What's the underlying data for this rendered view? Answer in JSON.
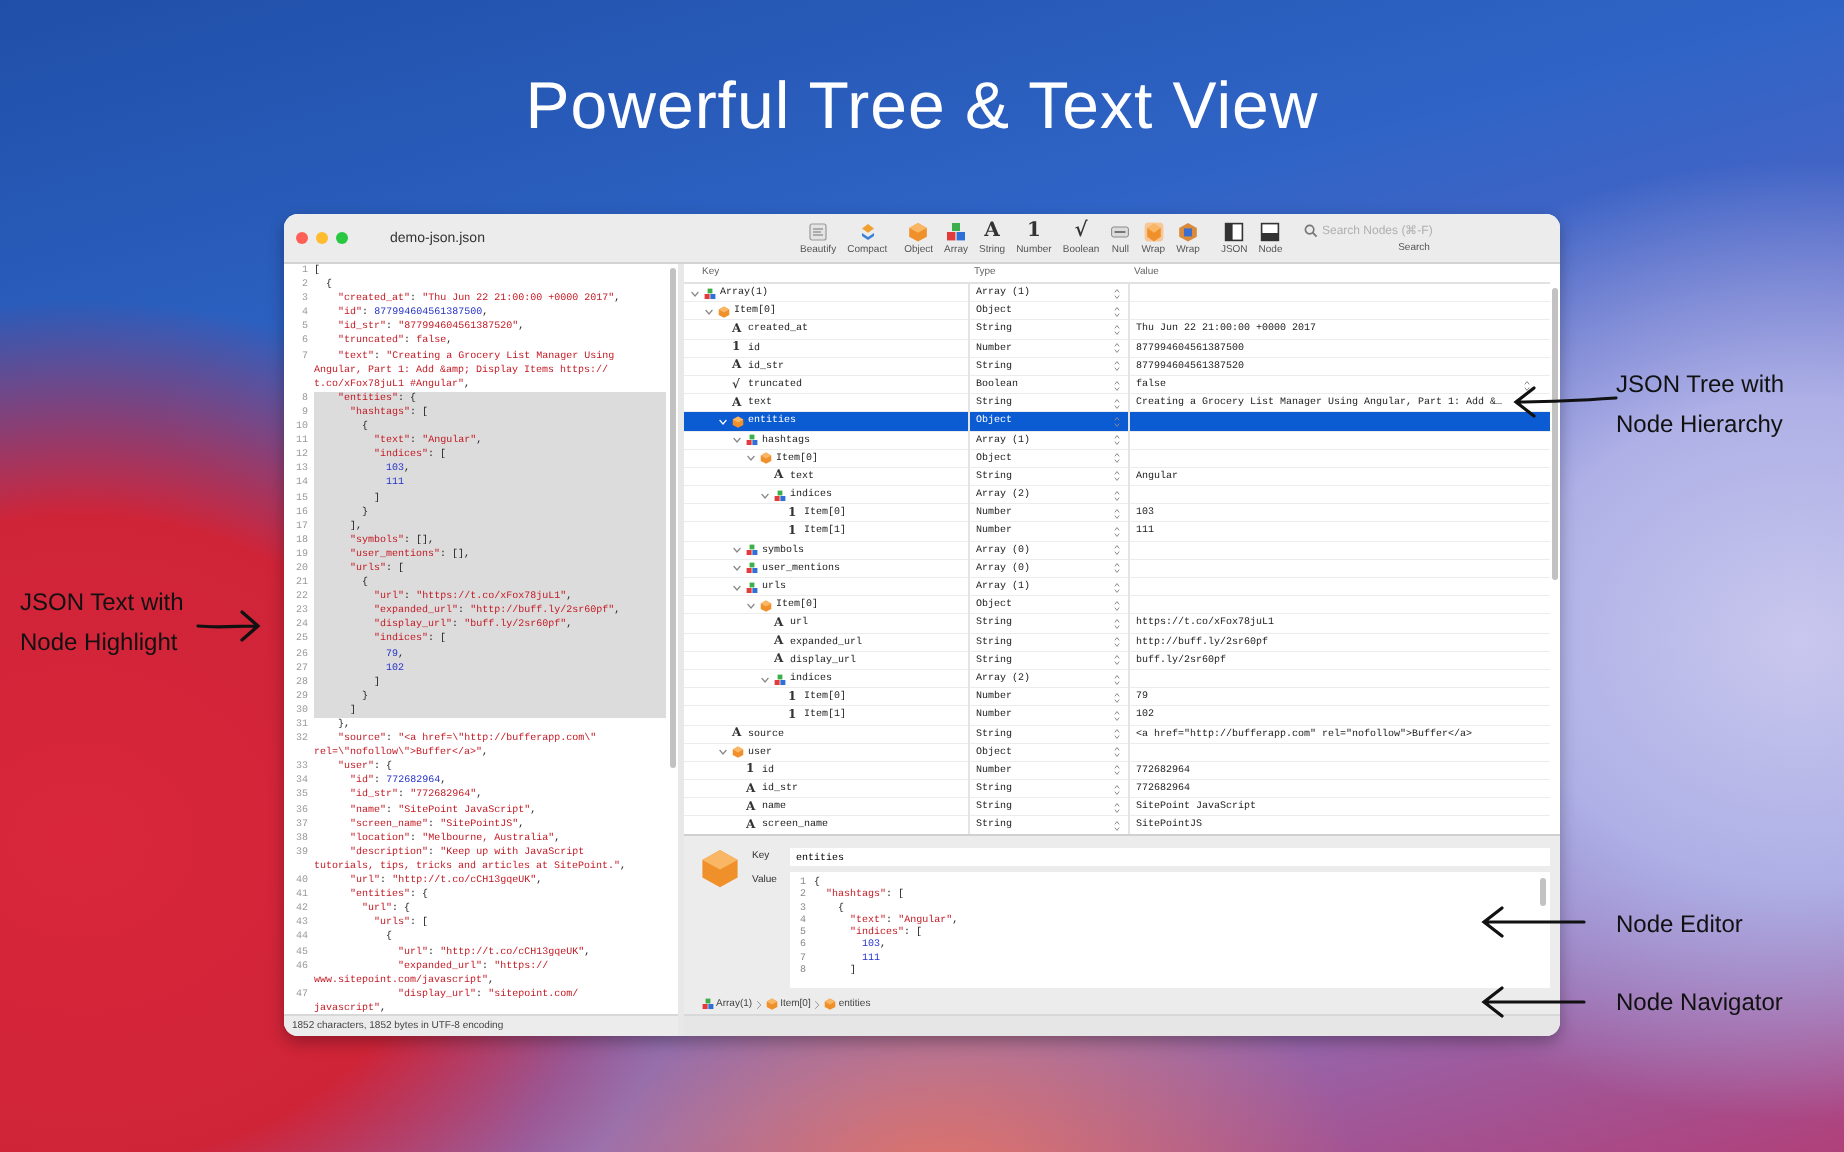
{
  "page_title": "Powerful Tree & Text View",
  "annotations": [
    {
      "kind": "tree",
      "lines": [
        "JSON Tree with",
        "Node Hierarchy"
      ]
    },
    {
      "kind": "text",
      "lines": [
        "JSON Text with",
        "Node Highlight"
      ]
    },
    {
      "kind": "editor",
      "lines": [
        "Node Editor"
      ]
    },
    {
      "kind": "navigator",
      "lines": [
        "Node Navigator"
      ]
    }
  ],
  "window": {
    "title": "demo-json.json",
    "toolbar": [
      {
        "kind": "beautify",
        "label": "Beautify"
      },
      {
        "kind": "compact",
        "label": "Compact"
      },
      {
        "kind": "object",
        "label": "Object"
      },
      {
        "kind": "array",
        "label": "Array"
      },
      {
        "kind": "string",
        "label": "String",
        "icon": "A"
      },
      {
        "kind": "number",
        "label": "Number",
        "icon": "1"
      },
      {
        "kind": "boolean",
        "label": "Boolean",
        "icon": "√"
      },
      {
        "kind": "null",
        "label": "Null"
      },
      {
        "kind": "wrap-object",
        "label": "Wrap"
      },
      {
        "kind": "wrap-array",
        "label": "Wrap"
      },
      {
        "kind": "json-panel",
        "label": "JSON"
      },
      {
        "kind": "node-panel",
        "label": "Node"
      }
    ],
    "search": {
      "placeholder": "Search Nodes (⌘-F)",
      "label": "Search"
    }
  },
  "text_view": {
    "lines": [
      {
        "n": "1",
        "text": "[",
        "highlighted": false
      },
      {
        "n": "2",
        "text": "  {",
        "highlighted": false
      },
      {
        "n": "3",
        "text": "    \"created_at\": \"Thu Jun 22 21:00:00 +0000 2017\",",
        "highlighted": false
      },
      {
        "n": "4",
        "text": "    \"id\": 877994604561387500,",
        "highlighted": false
      },
      {
        "n": "5",
        "text": "    \"id_str\": \"877994604561387520\",",
        "highlighted": false
      },
      {
        "n": "6",
        "text": "    \"truncated\": false,",
        "highlighted": false
      },
      {
        "n": "7",
        "text": "    \"text\": \"Creating a Grocery List Manager Using",
        "highlighted": false
      },
      {
        "text": "Angular, Part 1: Add &amp; Display Items https://",
        "highlighted": false
      },
      {
        "text": "t.co/xFox78juL1 #Angular\",",
        "highlighted": false
      },
      {
        "n": "8",
        "text": "    \"entities\": {",
        "highlighted": true
      },
      {
        "n": "9",
        "text": "      \"hashtags\": [",
        "highlighted": true
      },
      {
        "n": "10",
        "text": "        {",
        "highlighted": true
      },
      {
        "n": "11",
        "text": "          \"text\": \"Angular\",",
        "highlighted": true
      },
      {
        "n": "12",
        "text": "          \"indices\": [",
        "highlighted": true
      },
      {
        "n": "13",
        "text": "            103,",
        "highlighted": true
      },
      {
        "n": "14",
        "text": "            111",
        "highlighted": true
      },
      {
        "n": "15",
        "text": "          ]",
        "highlighted": true
      },
      {
        "n": "16",
        "text": "        }",
        "highlighted": true
      },
      {
        "n": "17",
        "text": "      ],",
        "highlighted": true
      },
      {
        "n": "18",
        "text": "      \"symbols\": [],",
        "highlighted": true
      },
      {
        "n": "19",
        "text": "      \"user_mentions\": [],",
        "highlighted": true
      },
      {
        "n": "20",
        "text": "      \"urls\": [",
        "highlighted": true
      },
      {
        "n": "21",
        "text": "        {",
        "highlighted": true
      },
      {
        "n": "22",
        "text": "          \"url\": \"https://t.co/xFox78juL1\",",
        "highlighted": true
      },
      {
        "n": "23",
        "text": "          \"expanded_url\": \"http://buff.ly/2sr60pf\",",
        "highlighted": true
      },
      {
        "n": "24",
        "text": "          \"display_url\": \"buff.ly/2sr60pf\",",
        "highlighted": true
      },
      {
        "n": "25",
        "text": "          \"indices\": [",
        "highlighted": true
      },
      {
        "n": "26",
        "text": "            79,",
        "highlighted": true
      },
      {
        "n": "27",
        "text": "            102",
        "highlighted": true
      },
      {
        "n": "28",
        "text": "          ]",
        "highlighted": true
      },
      {
        "n": "29",
        "text": "        }",
        "highlighted": true
      },
      {
        "n": "30",
        "text": "      ]",
        "highlighted": true
      },
      {
        "n": "31",
        "text": "    },",
        "highlighted": false
      },
      {
        "n": "32",
        "text": "    \"source\": \"<a href=\\\"http://bufferapp.com\\\"",
        "highlighted": false
      },
      {
        "text": "rel=\\\"nofollow\\\">Buffer</a>\",",
        "highlighted": false
      },
      {
        "n": "33",
        "text": "    \"user\": {",
        "highlighted": false
      },
      {
        "n": "34",
        "text": "      \"id\": 772682964,",
        "highlighted": false
      },
      {
        "n": "35",
        "text": "      \"id_str\": \"772682964\",",
        "highlighted": false
      },
      {
        "n": "36",
        "text": "      \"name\": \"SitePoint JavaScript\",",
        "highlighted": false
      },
      {
        "n": "37",
        "text": "      \"screen_name\": \"SitePointJS\",",
        "highlighted": false
      },
      {
        "n": "38",
        "text": "      \"location\": \"Melbourne, Australia\",",
        "highlighted": false
      },
      {
        "n": "39",
        "text": "      \"description\": \"Keep up with JavaScript",
        "highlighted": false
      },
      {
        "text": "tutorials, tips, tricks and articles at SitePoint.\",",
        "highlighted": false
      },
      {
        "n": "40",
        "text": "      \"url\": \"http://t.co/cCH13gqeUK\",",
        "highlighted": false
      },
      {
        "n": "41",
        "text": "      \"entities\": {",
        "highlighted": false
      },
      {
        "n": "42",
        "text": "        \"url\": {",
        "highlighted": false
      },
      {
        "n": "43",
        "text": "          \"urls\": [",
        "highlighted": false
      },
      {
        "n": "44",
        "text": "            {",
        "highlighted": false
      },
      {
        "n": "45",
        "text": "              \"url\": \"http://t.co/cCH13gqeUK\",",
        "highlighted": false
      },
      {
        "n": "46",
        "text": "              \"expanded_url\": \"https://",
        "highlighted": false
      },
      {
        "text": "www.sitepoint.com/javascript\",",
        "highlighted": false
      },
      {
        "n": "47",
        "text": "              \"display_url\": \"sitepoint.com/",
        "highlighted": false
      },
      {
        "text": "javascript\",",
        "highlighted": false
      }
    ],
    "status": "1852 characters, 1852 bytes in UTF-8 encoding"
  },
  "tree": {
    "columns": [
      "Key",
      "Type",
      "Value"
    ],
    "nodes": [
      {
        "key": "Array(1)",
        "kind": "array",
        "type": "Array (1)",
        "expanded": true,
        "selected": false,
        "children": [
          {
            "key": "Item[0]",
            "kind": "object",
            "type": "Object",
            "expanded": true,
            "selected": false,
            "children": [
              {
                "key": "created_at",
                "kind": "string",
                "icon": "A",
                "type": "String",
                "value": "Thu Jun 22 21:00:00 +0000 2017",
                "selected": false
              },
              {
                "key": "id",
                "kind": "number",
                "icon": "1",
                "type": "Number",
                "value": "877994604561387500",
                "selected": false
              },
              {
                "key": "id_str",
                "kind": "string",
                "icon": "A",
                "type": "String",
                "value": "877994604561387520",
                "selected": false
              },
              {
                "key": "truncated",
                "kind": "boolean",
                "icon": "√",
                "type": "Boolean",
                "value": "false",
                "selected": false
              },
              {
                "key": "text",
                "kind": "string",
                "icon": "A",
                "type": "String",
                "value": "Creating a Grocery List Manager Using Angular, Part 1: Add &…",
                "selected": false
              },
              {
                "key": "entities",
                "kind": "object",
                "type": "Object",
                "expanded": true,
                "selected": true,
                "children": [
                  {
                    "key": "hashtags",
                    "kind": "array",
                    "type": "Array (1)",
                    "expanded": true,
                    "selected": false,
                    "children": [
                      {
                        "key": "Item[0]",
                        "kind": "object",
                        "type": "Object",
                        "expanded": true,
                        "selected": false,
                        "children": [
                          {
                            "key": "text",
                            "kind": "string",
                            "icon": "A",
                            "type": "String",
                            "value": "Angular",
                            "selected": false
                          },
                          {
                            "key": "indices",
                            "kind": "array",
                            "type": "Array (2)",
                            "expanded": true,
                            "selected": false,
                            "children": [
                              {
                                "key": "Item[0]",
                                "kind": "number",
                                "icon": "1",
                                "type": "Number",
                                "value": "103",
                                "selected": false
                              },
                              {
                                "key": "Item[1]",
                                "kind": "number",
                                "icon": "1",
                                "type": "Number",
                                "value": "111",
                                "selected": false
                              }
                            ]
                          }
                        ]
                      }
                    ]
                  },
                  {
                    "key": "symbols",
                    "kind": "array",
                    "type": "Array (0)",
                    "expanded": true,
                    "selected": false
                  },
                  {
                    "key": "user_mentions",
                    "kind": "array",
                    "type": "Array (0)",
                    "expanded": true,
                    "selected": false
                  },
                  {
                    "key": "urls",
                    "kind": "array",
                    "type": "Array (1)",
                    "expanded": true,
                    "selected": false,
                    "children": [
                      {
                        "key": "Item[0]",
                        "kind": "object",
                        "type": "Object",
                        "expanded": true,
                        "selected": false,
                        "children": [
                          {
                            "key": "url",
                            "kind": "string",
                            "icon": "A",
                            "type": "String",
                            "value": "https://t.co/xFox78juL1",
                            "selected": false
                          },
                          {
                            "key": "expanded_url",
                            "kind": "string",
                            "icon": "A",
                            "type": "String",
                            "value": "http://buff.ly/2sr60pf",
                            "selected": false
                          },
                          {
                            "key": "display_url",
                            "kind": "string",
                            "icon": "A",
                            "type": "String",
                            "value": "buff.ly/2sr60pf",
                            "selected": false
                          },
                          {
                            "key": "indices",
                            "kind": "array",
                            "type": "Array (2)",
                            "expanded": true,
                            "selected": false,
                            "children": [
                              {
                                "key": "Item[0]",
                                "kind": "number",
                                "icon": "1",
                                "type": "Number",
                                "value": "79",
                                "selected": false
                              },
                              {
                                "key": "Item[1]",
                                "kind": "number",
                                "icon": "1",
                                "type": "Number",
                                "value": "102",
                                "selected": false
                              }
                            ]
                          }
                        ]
                      }
                    ]
                  }
                ]
              },
              {
                "key": "source",
                "kind": "string",
                "icon": "A",
                "type": "String",
                "value": "<a href=\"http://bufferapp.com\" rel=\"nofollow\">Buffer</a>",
                "selected": false
              },
              {
                "key": "user",
                "kind": "object",
                "type": "Object",
                "expanded": true,
                "selected": false,
                "children": [
                  {
                    "key": "id",
                    "kind": "number",
                    "icon": "1",
                    "type": "Number",
                    "value": "772682964",
                    "selected": false
                  },
                  {
                    "key": "id_str",
                    "kind": "string",
                    "icon": "A",
                    "type": "String",
                    "value": "772682964",
                    "selected": false
                  },
                  {
                    "key": "name",
                    "kind": "string",
                    "icon": "A",
                    "type": "String",
                    "value": "SitePoint JavaScript",
                    "selected": false
                  },
                  {
                    "key": "screen_name",
                    "kind": "string",
                    "icon": "A",
                    "type": "String",
                    "value": "SitePointJS",
                    "selected": false
                  }
                ]
              }
            ]
          }
        ]
      }
    ]
  },
  "editor": {
    "key_label": "Key",
    "key": "entities",
    "value_label": "Value",
    "lines": [
      {
        "n": "1",
        "text": "{"
      },
      {
        "n": "2",
        "text": "  \"hashtags\": ["
      },
      {
        "n": "3",
        "text": "    {"
      },
      {
        "n": "4",
        "text": "      \"text\": \"Angular\","
      },
      {
        "n": "5",
        "text": "      \"indices\": ["
      },
      {
        "n": "6",
        "text": "        103,"
      },
      {
        "n": "7",
        "text": "        111"
      },
      {
        "n": "8",
        "text": "      ]"
      }
    ]
  },
  "navigator": [
    {
      "kind": "array",
      "label": "Array(1)"
    },
    {
      "kind": "object",
      "label": "Item[0]"
    },
    {
      "kind": "object",
      "label": "entities"
    }
  ]
}
